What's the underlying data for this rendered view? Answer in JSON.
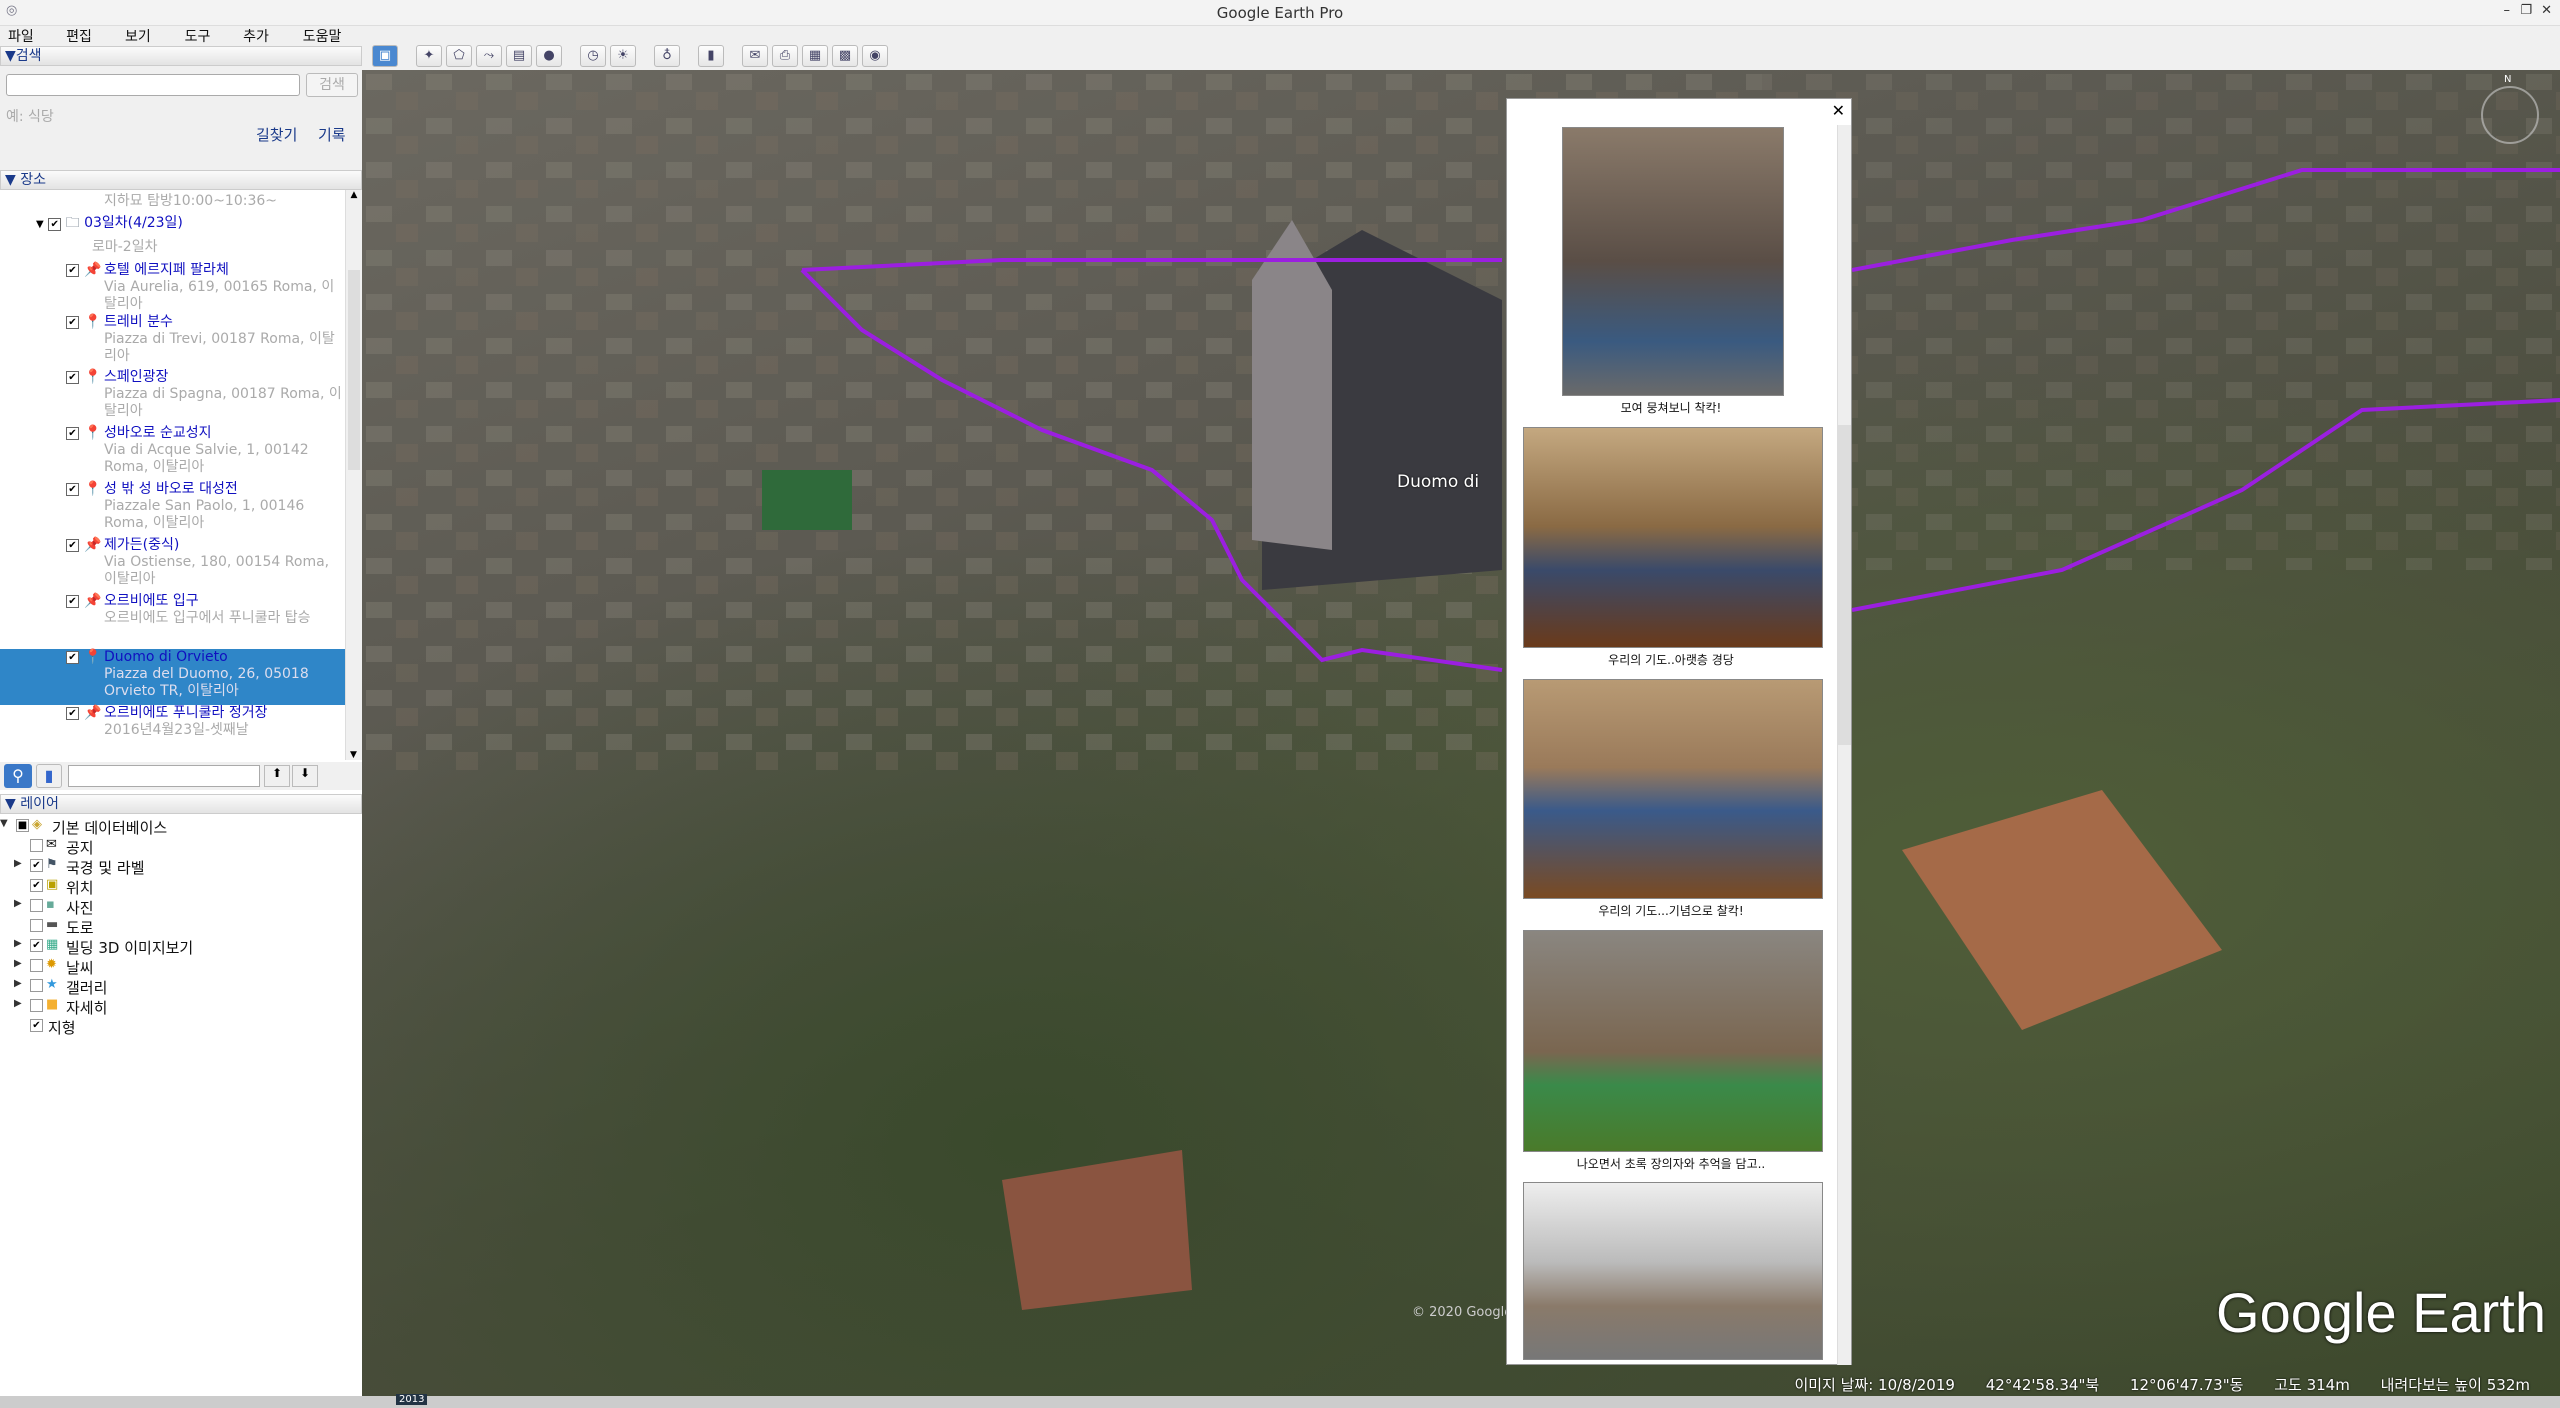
{
  "window": {
    "title": "Google Earth Pro",
    "minimize": "–",
    "restore": "❐",
    "close": "✕"
  },
  "menu": [
    "파일(F)",
    "편집(E)",
    "보기(V)",
    "도구(T)",
    "추가(A)",
    "도움말(H)"
  ],
  "toolbar": [
    {
      "icon": "sidebar-toggle-icon",
      "g": "▣"
    },
    {
      "icon": "add-placemark-icon",
      "g": "✦"
    },
    {
      "icon": "add-polygon-icon",
      "g": "⬠"
    },
    {
      "icon": "add-path-icon",
      "g": "⤳"
    },
    {
      "icon": "add-image-overlay-icon",
      "g": "▤"
    },
    {
      "icon": "record-tour-icon",
      "g": "●"
    },
    {
      "icon": "historical-imagery-icon",
      "g": "◷"
    },
    {
      "icon": "sunlight-icon",
      "g": "☀"
    },
    {
      "icon": "planets-icon",
      "g": "♁"
    },
    {
      "icon": "ruler-icon",
      "g": "▮"
    },
    {
      "icon": "email-icon",
      "g": "✉"
    },
    {
      "icon": "print-icon",
      "g": "⎙"
    },
    {
      "icon": "save-image-icon",
      "g": "▦"
    },
    {
      "icon": "view-in-maps-icon",
      "g": "▩"
    },
    {
      "icon": "earth-icon",
      "g": "◉"
    }
  ],
  "search": {
    "header": "▼검색",
    "placeholder": "",
    "button": "검색",
    "example": "예: 식당",
    "directions": "길찾기",
    "history": "기록"
  },
  "places": {
    "header": "▼ 장소",
    "top_text": "지하묘 탐방10:00~10:36~",
    "folder": "03일차(4/23일)",
    "folder_desc": "로마-2일차",
    "items": [
      {
        "name": "호텔 에르지페 팔라체",
        "addr": "Via Aurelia, 619, 00165 Roma, 이탈리아",
        "icon": "yellow-pushpin",
        "h": 52
      },
      {
        "name": "트레비 분수",
        "addr": "Piazza di Trevi, 00187 Roma, 이탈리아",
        "icon": "red-placemark",
        "h": 55
      },
      {
        "name": "스페인광장",
        "addr": "Piazza di Spagna, 00187 Roma, 이탈리아",
        "icon": "red-placemark",
        "h": 56
      },
      {
        "name": "성바오로 순교성지",
        "addr": "Via di Acque Salvie, 1, 00142 Roma, 이탈리아",
        "icon": "red-placemark",
        "h": 56
      },
      {
        "name": "성 밖 성 바오로 대성전",
        "addr": "Piazzale San Paolo, 1, 00146 Roma, 이탈리아",
        "icon": "red-placemark",
        "h": 56
      },
      {
        "name": "제가든(중식)",
        "addr": "Via Ostiense, 180, 00154 Roma, 이탈리아",
        "icon": "yellow-pushpin",
        "h": 56
      },
      {
        "name": "오르비에또 입구",
        "addr": "오르비에도 입구에서 푸니쿨라 탑승",
        "icon": "yellow-pushpin",
        "h": 56
      },
      {
        "name": "Duomo di Orvieto",
        "addr": "Piazza del Duomo, 26, 05018 Orvieto TR, 이탈리아",
        "icon": "red-placemark",
        "h": 56,
        "selected": true
      },
      {
        "name": "오르비에또 푸니쿨라 정거장",
        "addr": "2016년4월23일-셋째날",
        "icon": "yellow-pushpin",
        "h": 50
      }
    ]
  },
  "layers": {
    "header": "▼ 레이어",
    "items": [
      {
        "label": "기본 데이터베이스",
        "checked": "partial",
        "icon": "layers-icon",
        "g": "◈",
        "c": "#c9a530",
        "arrow": "▼",
        "indent": 0
      },
      {
        "label": "공지",
        "checked": false,
        "icon": "envelope-icon",
        "g": "✉",
        "c": "#111",
        "indent": 1
      },
      {
        "label": "국경 및 라벨",
        "checked": true,
        "icon": "flag-icon",
        "g": "⚑",
        "c": "#456",
        "arrow": "▶",
        "indent": 1
      },
      {
        "label": "위치",
        "checked": true,
        "icon": "place-icon",
        "g": "▣",
        "c": "#b9a000",
        "indent": 1
      },
      {
        "label": "사진",
        "checked": false,
        "icon": "photo-icon",
        "g": "▪",
        "c": "#6a9",
        "arrow": "▶",
        "indent": 1
      },
      {
        "label": "도로",
        "checked": false,
        "icon": "road-icon",
        "g": "▬",
        "c": "#555",
        "indent": 1
      },
      {
        "label": "빌딩 3D 이미지보기",
        "checked": true,
        "icon": "building-3d-icon",
        "g": "▦",
        "c": "#3a8",
        "arrow": "▶",
        "indent": 1
      },
      {
        "label": "날씨",
        "checked": false,
        "icon": "sun-icon",
        "g": "✹",
        "c": "#d90",
        "arrow": "▶",
        "indent": 1
      },
      {
        "label": "갤러리",
        "checked": false,
        "icon": "star-icon",
        "g": "★",
        "c": "#39d",
        "arrow": "▶",
        "indent": 1
      },
      {
        "label": "자세히",
        "checked": false,
        "icon": "note-icon",
        "g": "■",
        "c": "#f4b030",
        "arrow": "▶",
        "indent": 1
      },
      {
        "label": "지형",
        "checked": true,
        "icon": "",
        "g": "",
        "c": "#000",
        "indent": 0
      }
    ]
  },
  "popup": {
    "close": "✕",
    "captions": [
      "모여 뭉쳐보니 착칵!",
      "우리의 기도..아랫층 경당",
      "우리의 기도...기념으로 찰칵!",
      "나오면서 초록 장의자와 추억을 담고.."
    ]
  },
  "map": {
    "label": "Duomo di",
    "copyright": "© 2020 Google",
    "route_color": "#9b1fe0",
    "compass": "N"
  },
  "status": {
    "date": "이미지 날짜: 10/8/2019",
    "lat": "42°42'58.34\"북",
    "lon": "12°06'47.73\"동",
    "elev": "고도  314m",
    "eye": "내려다보는 높이   532m"
  },
  "logo": "Google Earth",
  "taskbar_clock": "2013"
}
